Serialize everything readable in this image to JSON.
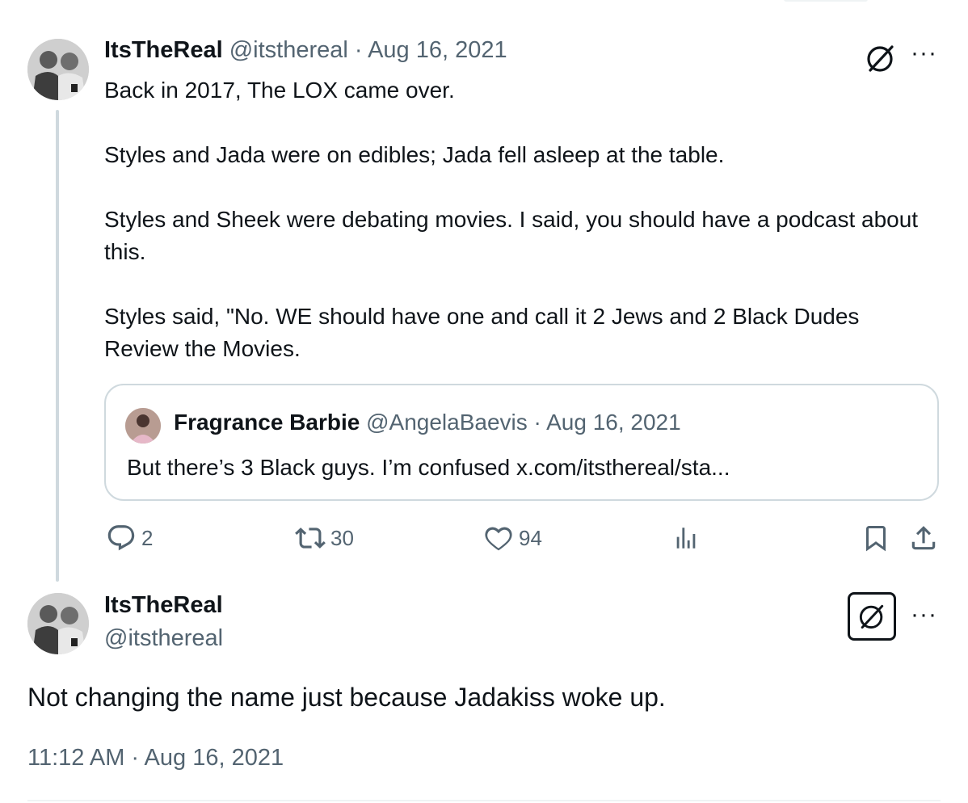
{
  "post1": {
    "name": "ItsTheReal",
    "handle": "@itsthereal",
    "sep": "·",
    "date": "Aug 16, 2021",
    "paragraphs": [
      "Back in 2017, The LOX came over.",
      "Styles and Jada were on edibles; Jada fell asleep at the table.",
      "Styles and Sheek were debating movies. I said, you should have a podcast about this.",
      "Styles said, \"No. WE should have one and call it 2 Jews and 2 Black Dudes Review the Movies."
    ],
    "quote": {
      "name": "Fragrance Barbie",
      "handle": "@AngelaBaevis",
      "sep": "·",
      "date": "Aug 16, 2021",
      "text": "But there’s 3 Black guys. I’m confused x.com/itsthereal/sta..."
    },
    "actions": {
      "replies": "2",
      "reposts": "30",
      "likes": "94"
    }
  },
  "post2": {
    "name": "ItsTheReal",
    "handle": "@itsthereal",
    "text": "Not changing the name just because Jadakiss woke up.",
    "timestamp": "11:12 AM · Aug 16, 2021"
  },
  "more_label": "···",
  "colors": {
    "text": "#0f1419",
    "muted": "#536471",
    "border": "#cfd9de",
    "thread_line": "#cfd9de"
  },
  "icons": [
    "grok-icon",
    "more-icon",
    "reply-icon",
    "repost-icon",
    "like-icon",
    "views-icon",
    "bookmark-icon",
    "share-icon"
  ]
}
